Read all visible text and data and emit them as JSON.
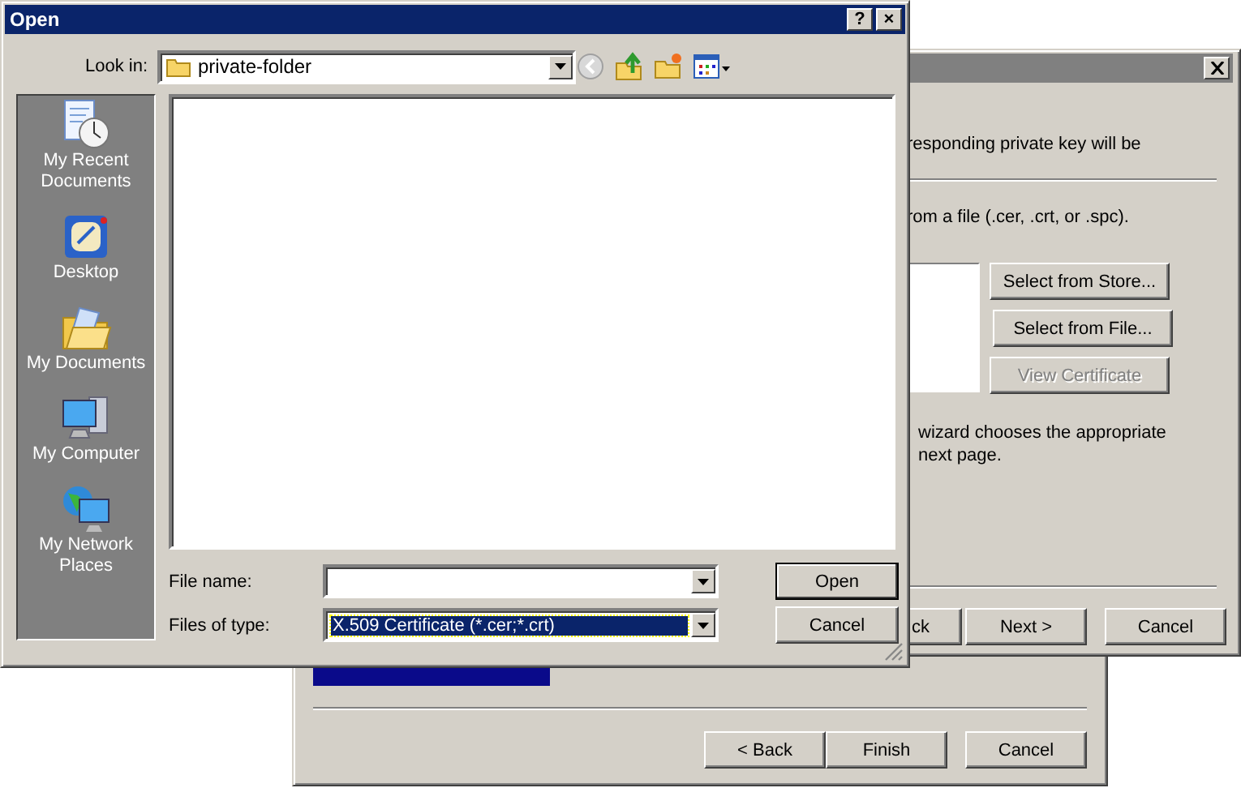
{
  "back_window": {
    "buttons": [
      {
        "label": "< Back",
        "disabled": false
      },
      {
        "label": "Finish",
        "disabled": false
      },
      {
        "label": "Cancel",
        "disabled": false
      }
    ]
  },
  "wizard": {
    "texts": [
      "responding private key will be",
      "rom a file (.cer, .crt, or .spc).",
      "wizard chooses the appropriate",
      "next page."
    ],
    "side_buttons": [
      {
        "label": "Select from Store...",
        "disabled": false
      },
      {
        "label": "Select from File...",
        "disabled": false
      },
      {
        "label": "View Certificate",
        "disabled": true
      }
    ],
    "buttons": [
      {
        "label": "ck",
        "disabled": false
      },
      {
        "label": "Next >",
        "disabled": false
      },
      {
        "label": "Cancel",
        "disabled": false
      }
    ]
  },
  "open_dialog": {
    "title": "Open",
    "title_buttons": [
      "?",
      "×"
    ],
    "look_in": {
      "label": "Look in:",
      "value": "private-folder"
    },
    "places": [
      {
        "label": "My Recent Documents",
        "kind": "recent"
      },
      {
        "label": "Desktop",
        "kind": "desktop"
      },
      {
        "label": "My Documents",
        "kind": "documents"
      },
      {
        "label": "My Computer",
        "kind": "computer"
      },
      {
        "label": "My Network Places",
        "kind": "network"
      }
    ],
    "file_name": {
      "label": "File name:"
    },
    "files_of_type": {
      "label": "Files of type:",
      "value": "X.509 Certificate (*.cer;*.crt)",
      "selected": true
    },
    "buttons": [
      {
        "label": "Open",
        "default": true
      },
      {
        "label": "Cancel",
        "default": false
      }
    ]
  }
}
